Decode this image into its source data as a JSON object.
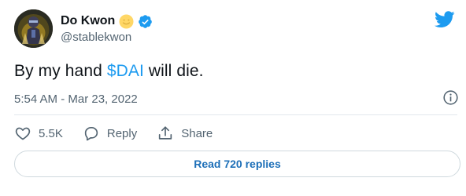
{
  "author": {
    "display_name": "Do Kwon",
    "handle": "@stablekwon",
    "emoji": "smiling-face-emoji",
    "verified": true
  },
  "tweet": {
    "text_before": "By my hand ",
    "cashtag": "$DAI",
    "text_after": " will die.",
    "timestamp": "5:54 AM - Mar 23, 2022"
  },
  "actions": {
    "like_count": "5.5K",
    "reply_label": "Reply",
    "share_label": "Share"
  },
  "read_replies_label": "Read 720 replies",
  "colors": {
    "accent": "#1d9bf0",
    "link_button": "#1d6fb8",
    "secondary_text": "#536471",
    "divider": "#e1e8ed"
  },
  "icons": [
    "twitter-logo-icon",
    "verified-badge-icon",
    "info-icon",
    "heart-icon",
    "reply-bubble-icon",
    "share-icon"
  ]
}
